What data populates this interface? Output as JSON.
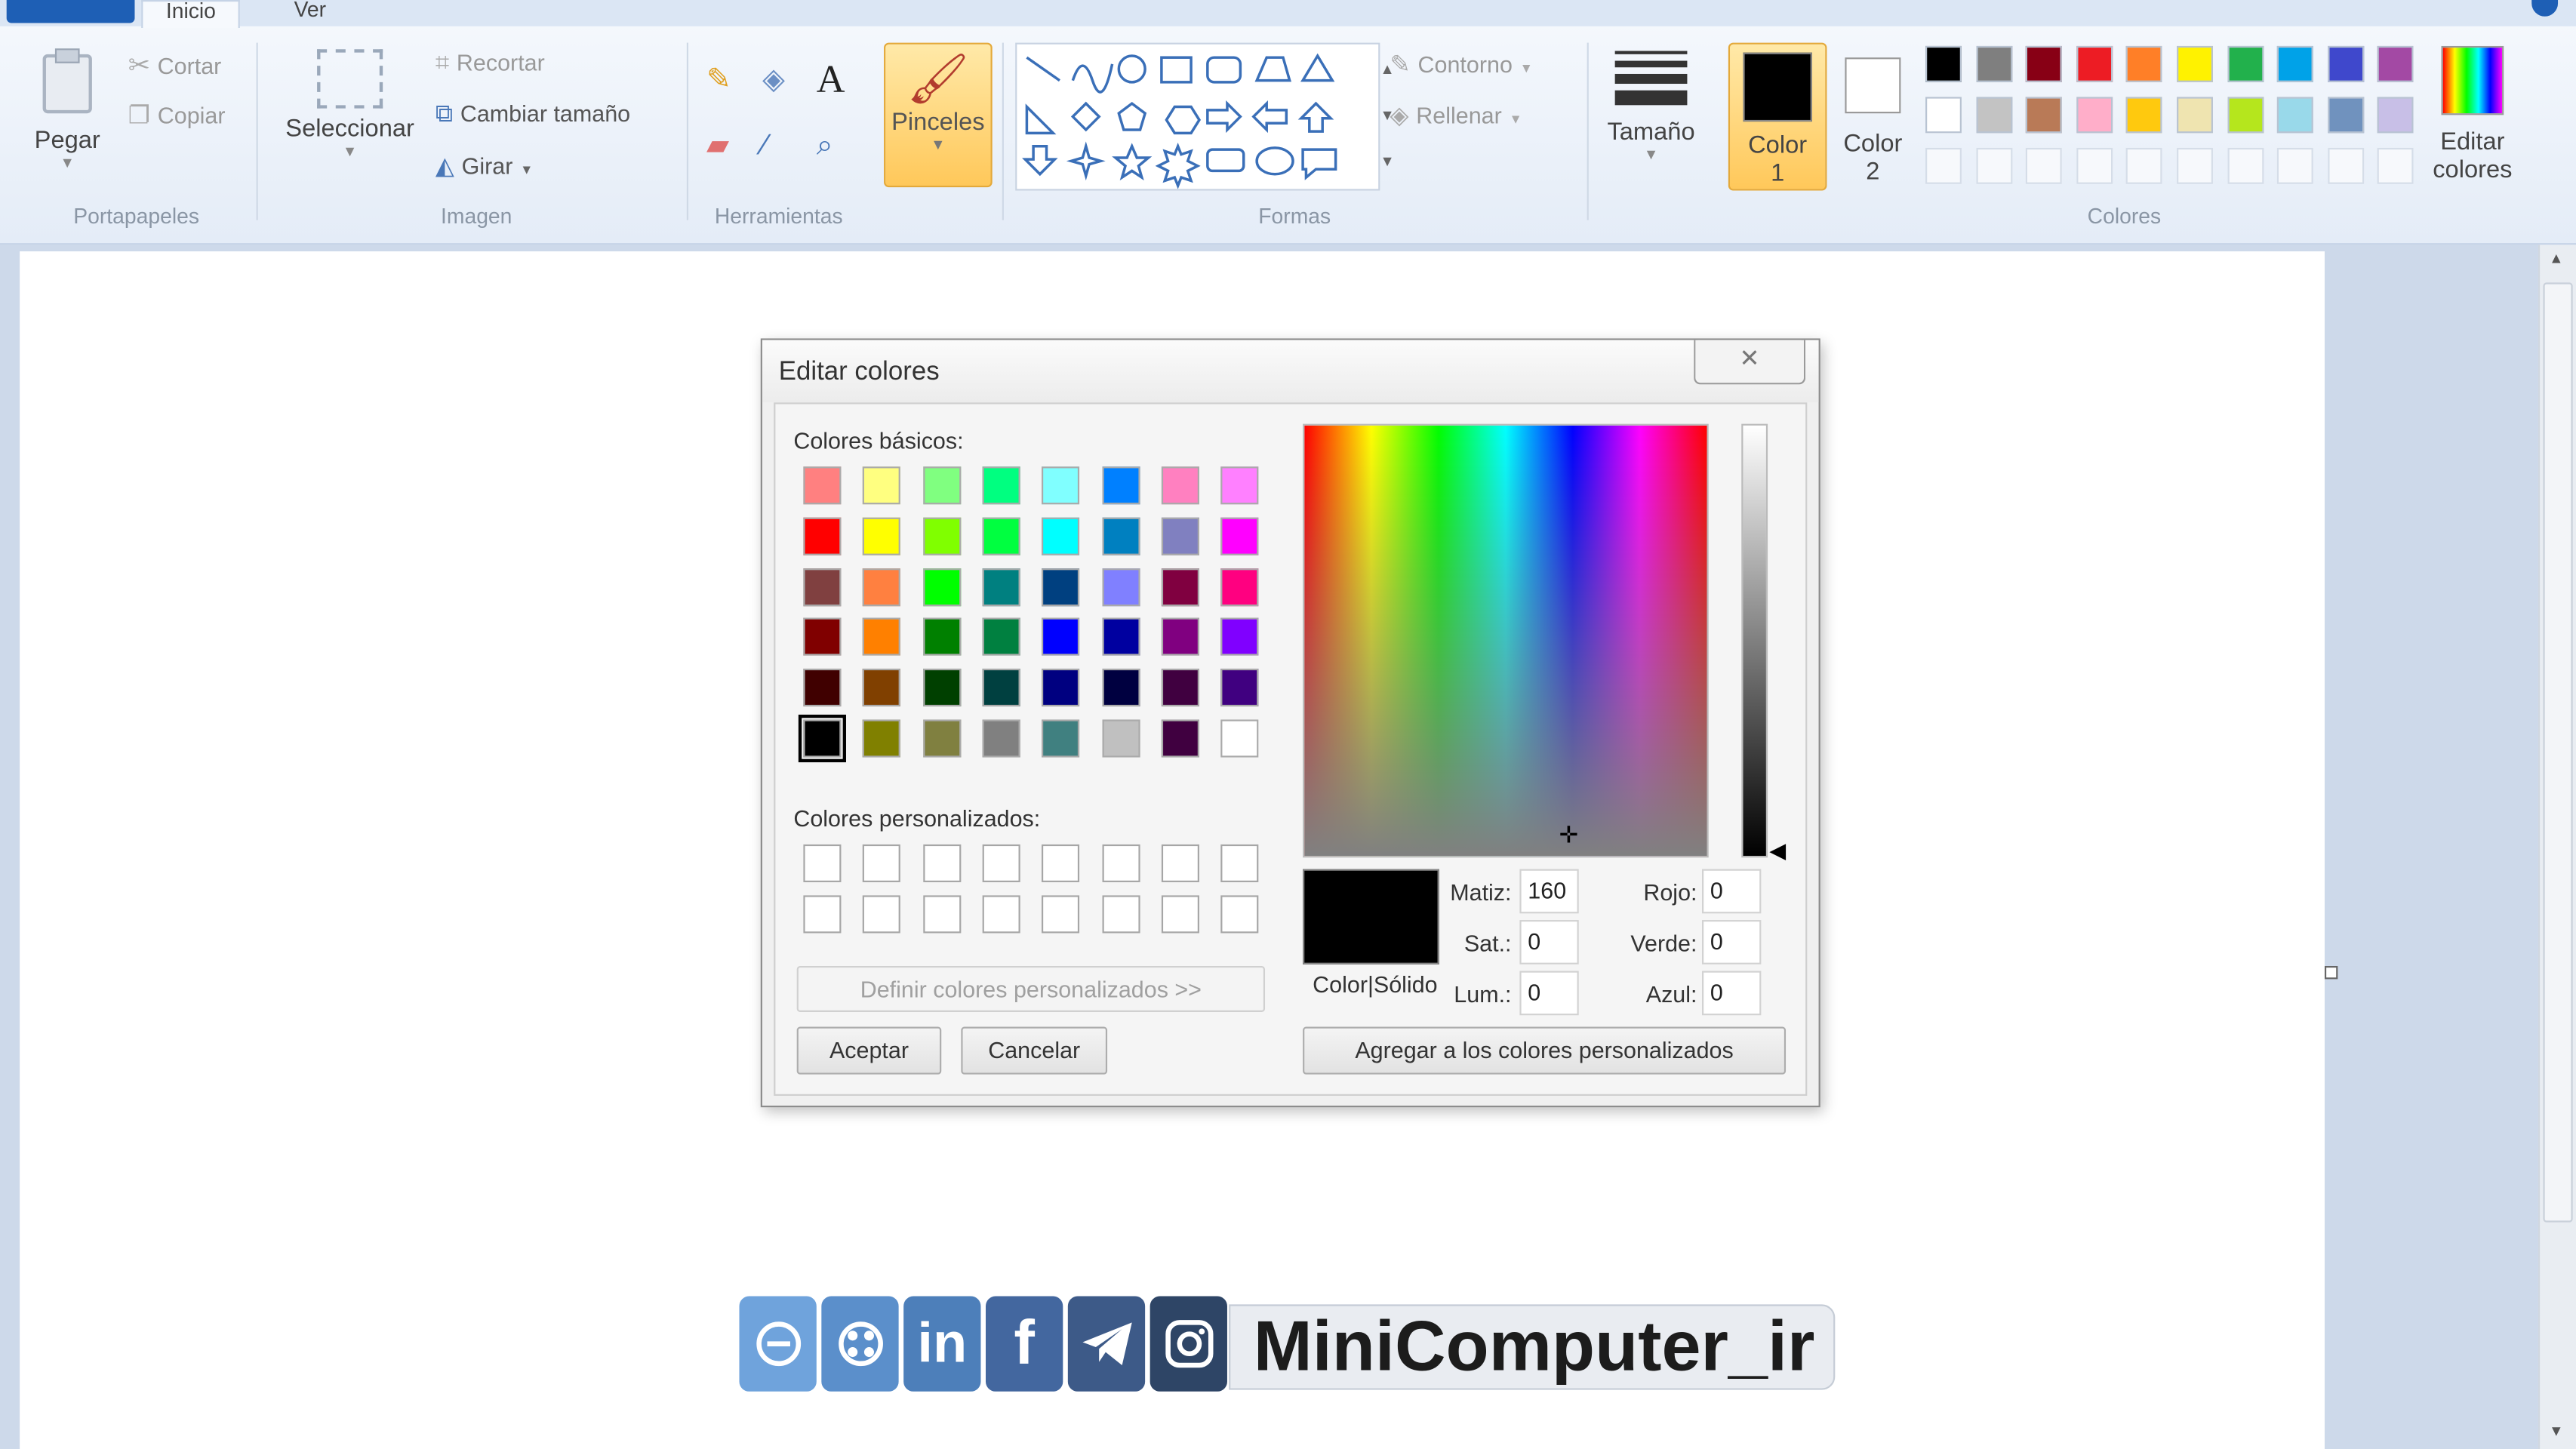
{
  "ribbon": {
    "tabs": [
      "Inicio",
      "Ver"
    ],
    "groups": {
      "portapapeles": {
        "label": "Portapapeles",
        "paste": "Pegar",
        "cut": "Cortar",
        "copy": "Copiar"
      },
      "imagen": {
        "label": "Imagen",
        "select": "Seleccionar",
        "crop": "Recortar",
        "resize": "Cambiar tamaño",
        "rotate": "Girar"
      },
      "herramientas": {
        "label": "Herramientas"
      },
      "pinceles": {
        "label": "Pinceles"
      },
      "formas": {
        "label": "Formas",
        "outline": "Contorno",
        "fill": "Rellenar"
      },
      "tamano": {
        "label": "Tamaño"
      },
      "color1": {
        "line1": "Color",
        "line2": "1"
      },
      "color2": {
        "line1": "Color",
        "line2": "2"
      },
      "colores": {
        "label": "Colores",
        "edit_line1": "Editar",
        "edit_line2": "colores"
      }
    },
    "palette_row1": [
      "#000000",
      "#7f7f7f",
      "#880015",
      "#ed1c24",
      "#ff7f27",
      "#fff200",
      "#22b14c",
      "#00a2e8",
      "#3f48cc",
      "#a349a4"
    ],
    "palette_row2": [
      "#ffffff",
      "#c3c3c3",
      "#b97a57",
      "#ffaec9",
      "#ffc90e",
      "#efe4b0",
      "#b5e61d",
      "#99d9ea",
      "#7092be",
      "#c8bfe7"
    ]
  },
  "dialog": {
    "title": "Editar colores",
    "basic_label": "Colores básicos:",
    "basic_colors": [
      [
        "#ff8080",
        "#ffff80",
        "#80ff80",
        "#00ff80",
        "#80ffff",
        "#0080ff",
        "#ff80c0",
        "#ff80ff"
      ],
      [
        "#ff0000",
        "#ffff00",
        "#80ff00",
        "#00ff40",
        "#00ffff",
        "#0080c0",
        "#8080c0",
        "#ff00ff"
      ],
      [
        "#804040",
        "#ff8040",
        "#00ff00",
        "#008080",
        "#004080",
        "#8080ff",
        "#800040",
        "#ff0080"
      ],
      [
        "#800000",
        "#ff8000",
        "#008000",
        "#008040",
        "#0000ff",
        "#0000a0",
        "#800080",
        "#8000ff"
      ],
      [
        "#400000",
        "#804000",
        "#004000",
        "#004040",
        "#000080",
        "#000040",
        "#400040",
        "#400080"
      ],
      [
        "#000000",
        "#808000",
        "#808040",
        "#808080",
        "#408080",
        "#c0c0c0",
        "#400040",
        "#ffffff"
      ]
    ],
    "custom_label": "Colores personalizados:",
    "define_button": "Definir colores personalizados >>",
    "ok_button": "Aceptar",
    "cancel_button": "Cancelar",
    "color_solid_label": "Color|Sólido",
    "fields": {
      "hue_label": "Matiz:",
      "hue": "160",
      "sat_label": "Sat.:",
      "sat": "0",
      "lum_label": "Lum.:",
      "lum": "0",
      "red_label": "Rojo:",
      "red": "0",
      "green_label": "Verde:",
      "green": "0",
      "blue_label": "Azul:",
      "blue": "0"
    },
    "add_button": "Agregar a los colores personalizados"
  },
  "watermark": {
    "text": "MiniComputer_ir",
    "icons": [
      "edge-icon",
      "aparat-icon",
      "linkedin-icon",
      "facebook-icon",
      "telegram-icon",
      "instagram-icon"
    ]
  }
}
